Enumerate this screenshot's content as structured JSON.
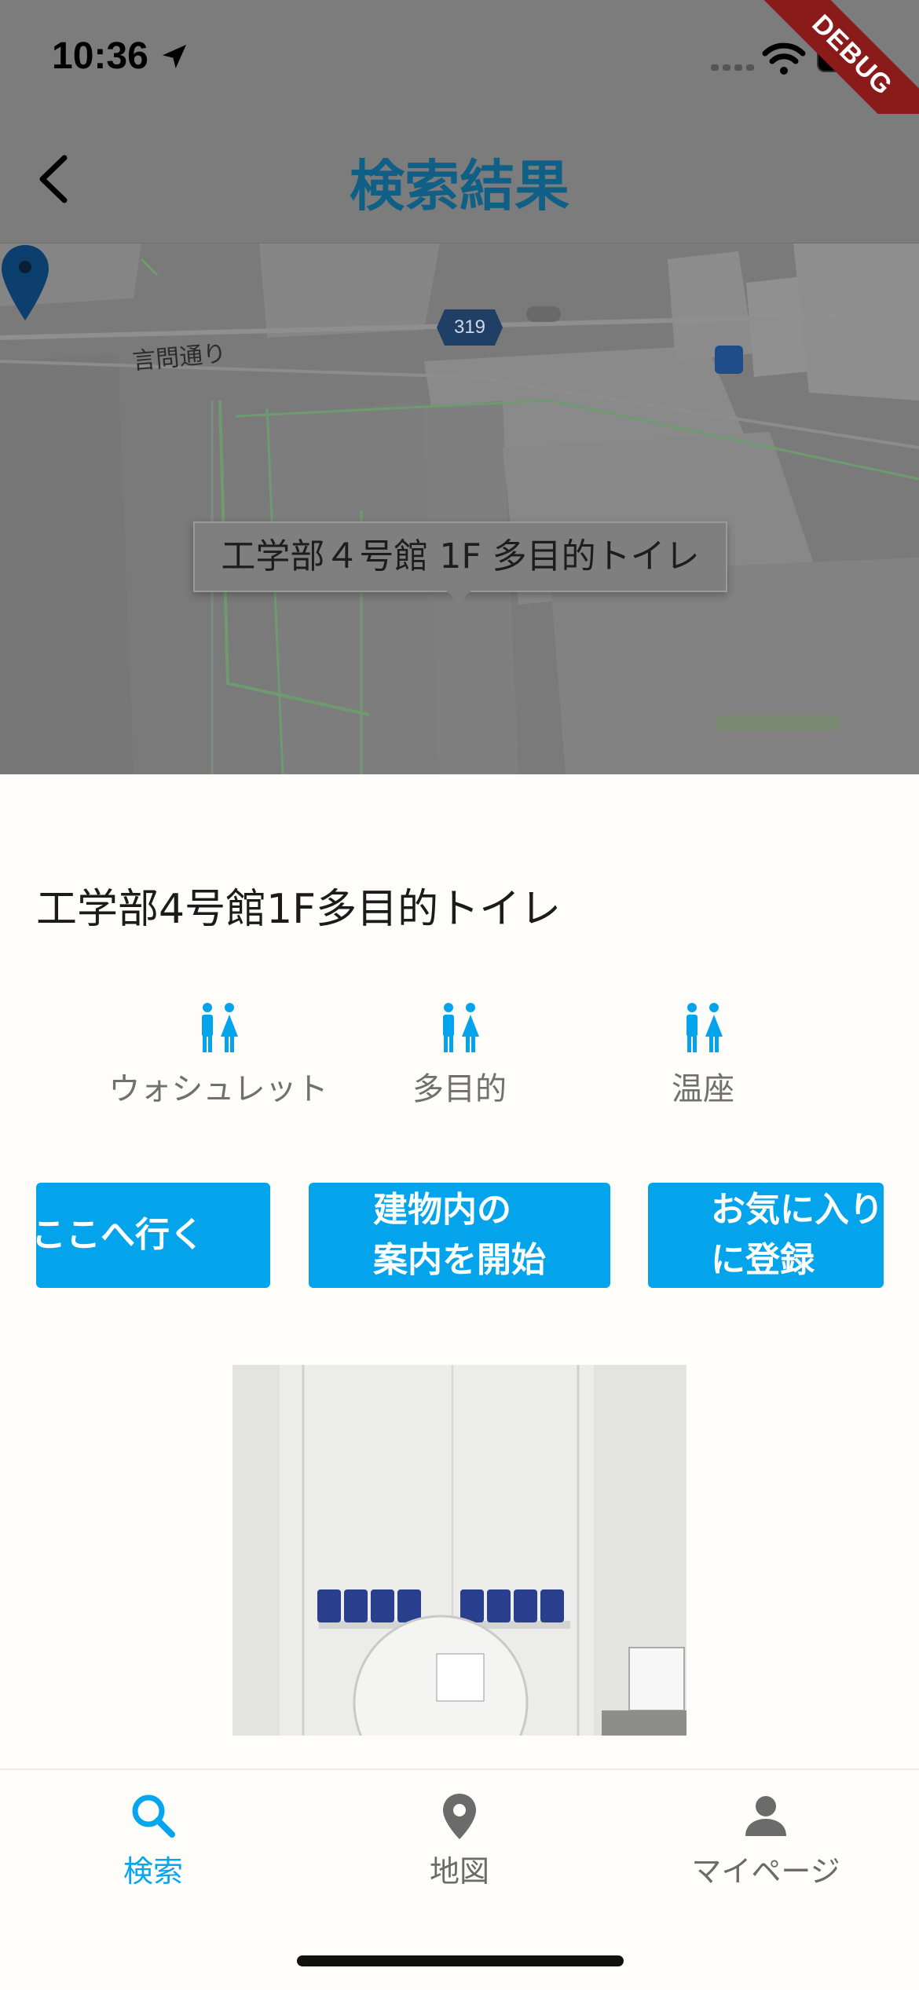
{
  "status_bar": {
    "time": "10:36",
    "debug_banner": "DEBUG"
  },
  "app_bar": {
    "title": "検索結果",
    "back_icon": "chevron-left-icon"
  },
  "map": {
    "road_label": "言問通り",
    "route_number": "319",
    "marker_label": "工学部４号館 1F 多目的トイレ"
  },
  "place": {
    "title": "工学部4号館1F多目的トイレ"
  },
  "amenities": [
    {
      "icon": "restroom-icon",
      "label": "ウォシュレット"
    },
    {
      "icon": "restroom-icon",
      "label": "多目的"
    },
    {
      "icon": "restroom-icon",
      "label": "温座"
    }
  ],
  "actions": {
    "go_here": "ここへ行く",
    "start_guide_line1": "建物内の",
    "start_guide_line2": "案内を開始",
    "favorite_line1": "お気に入り",
    "favorite_line2": "に登録"
  },
  "bottom_nav": [
    {
      "icon": "search-icon",
      "label": "検索",
      "active": true
    },
    {
      "icon": "map-pin-icon",
      "label": "地図",
      "active": false
    },
    {
      "icon": "person-icon",
      "label": "マイページ",
      "active": false
    }
  ],
  "colors": {
    "accent": "#03A4EC",
    "title": "#0F5F86",
    "overlay": "#7C7C7C"
  }
}
